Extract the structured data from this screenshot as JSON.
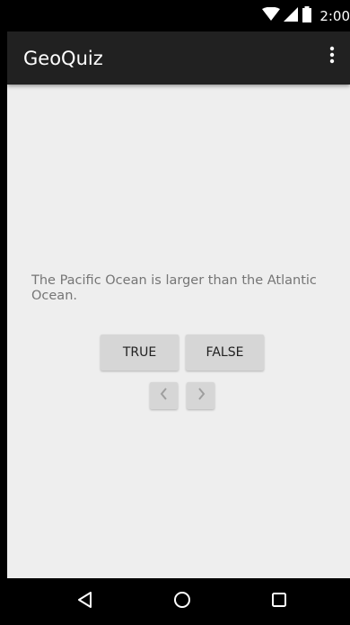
{
  "status_bar": {
    "time": "2:00",
    "icons": [
      "wifi-icon",
      "cell-signal-icon",
      "battery-icon"
    ]
  },
  "app_bar": {
    "title": "GeoQuiz",
    "menu_icon": "overflow-menu-icon"
  },
  "quiz": {
    "question": "The Pacific Ocean is larger than the Atlantic Ocean.",
    "true_label": "TRUE",
    "false_label": "FALSE",
    "prev_label": "❮",
    "next_label": "❯"
  },
  "nav_bar": {
    "icons": [
      "back-icon",
      "home-icon",
      "recents-icon"
    ]
  },
  "colors": {
    "status_bar": "#000000",
    "app_bar": "#212121",
    "background": "#eeeeee",
    "button": "#d6d6d6",
    "question_text": "#757575"
  }
}
